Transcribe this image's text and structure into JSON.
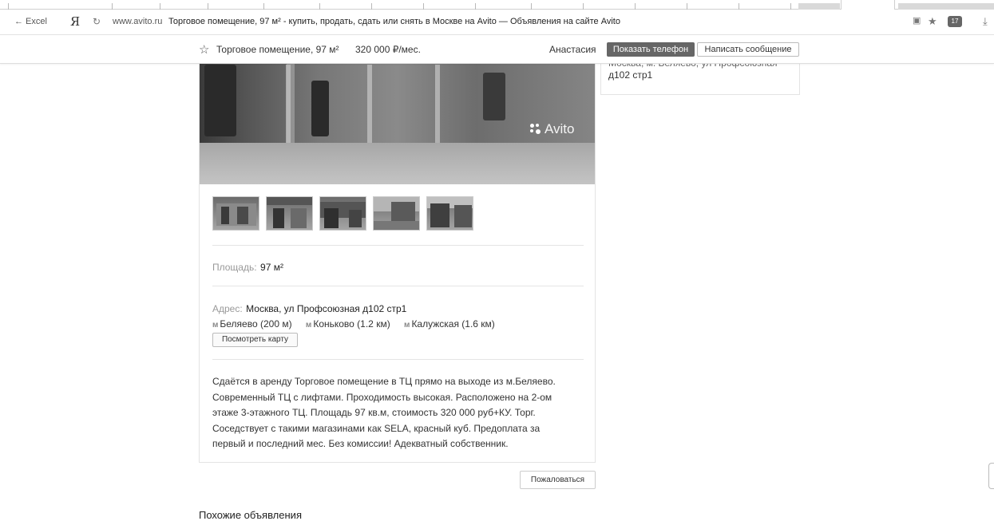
{
  "browser": {
    "back_label": "← Excel",
    "ya": "Я",
    "domain": "www.avito.ru",
    "page_title": "Торговое помещение, 97 м² - купить, продать, сдать или снять в Москве на Avito — Объявления на сайте Avito",
    "ext_badge": "17"
  },
  "header": {
    "title": "Торговое помещение, 97 м²",
    "price": "320 000 ₽/мес.",
    "seller": "Анастасия",
    "phone_button": "Показать телефон",
    "message_button": "Написать сообщение"
  },
  "side": {
    "address_line1": "Москва, м. Беляево, ул Профсоюзная",
    "address_line2": "д102 стр1"
  },
  "photo": {
    "watermark": "Avito",
    "thumbs_count": 5
  },
  "params": {
    "area_label": "Площадь:",
    "area_value": "97 м²",
    "address_label": "Адрес:",
    "address_value": "Москва, ул Профсоюзная д102 стр1",
    "metro": [
      {
        "icon": "м",
        "name": "Беляево (200 м)"
      },
      {
        "icon": "м",
        "name": "Коньково (1.2 км)"
      },
      {
        "icon": "м",
        "name": "Калужская (1.6 км)"
      }
    ],
    "map_button": "Посмотреть карту"
  },
  "description": {
    "line1": "Сдаётся в аренду Торговое помещение в ТЦ прямо на выходе из м.Беляево.",
    "line2": "Современный ТЦ с лифтами. Проходимость высокая. Расположено на 2-ом",
    "line3": "этаже 3-этажного ТЦ. Площадь 97 кв.м, стоимость 320 000 руб+КУ. Торг.",
    "line4": "Соседствует с такими магазинами как SELA, красный куб. Предоплата за",
    "line5": "первый и последний мес. Без комиссии! Адекватный собственник."
  },
  "footer": {
    "report_button": "Пожаловаться",
    "similar_title": "Похожие объявления"
  }
}
